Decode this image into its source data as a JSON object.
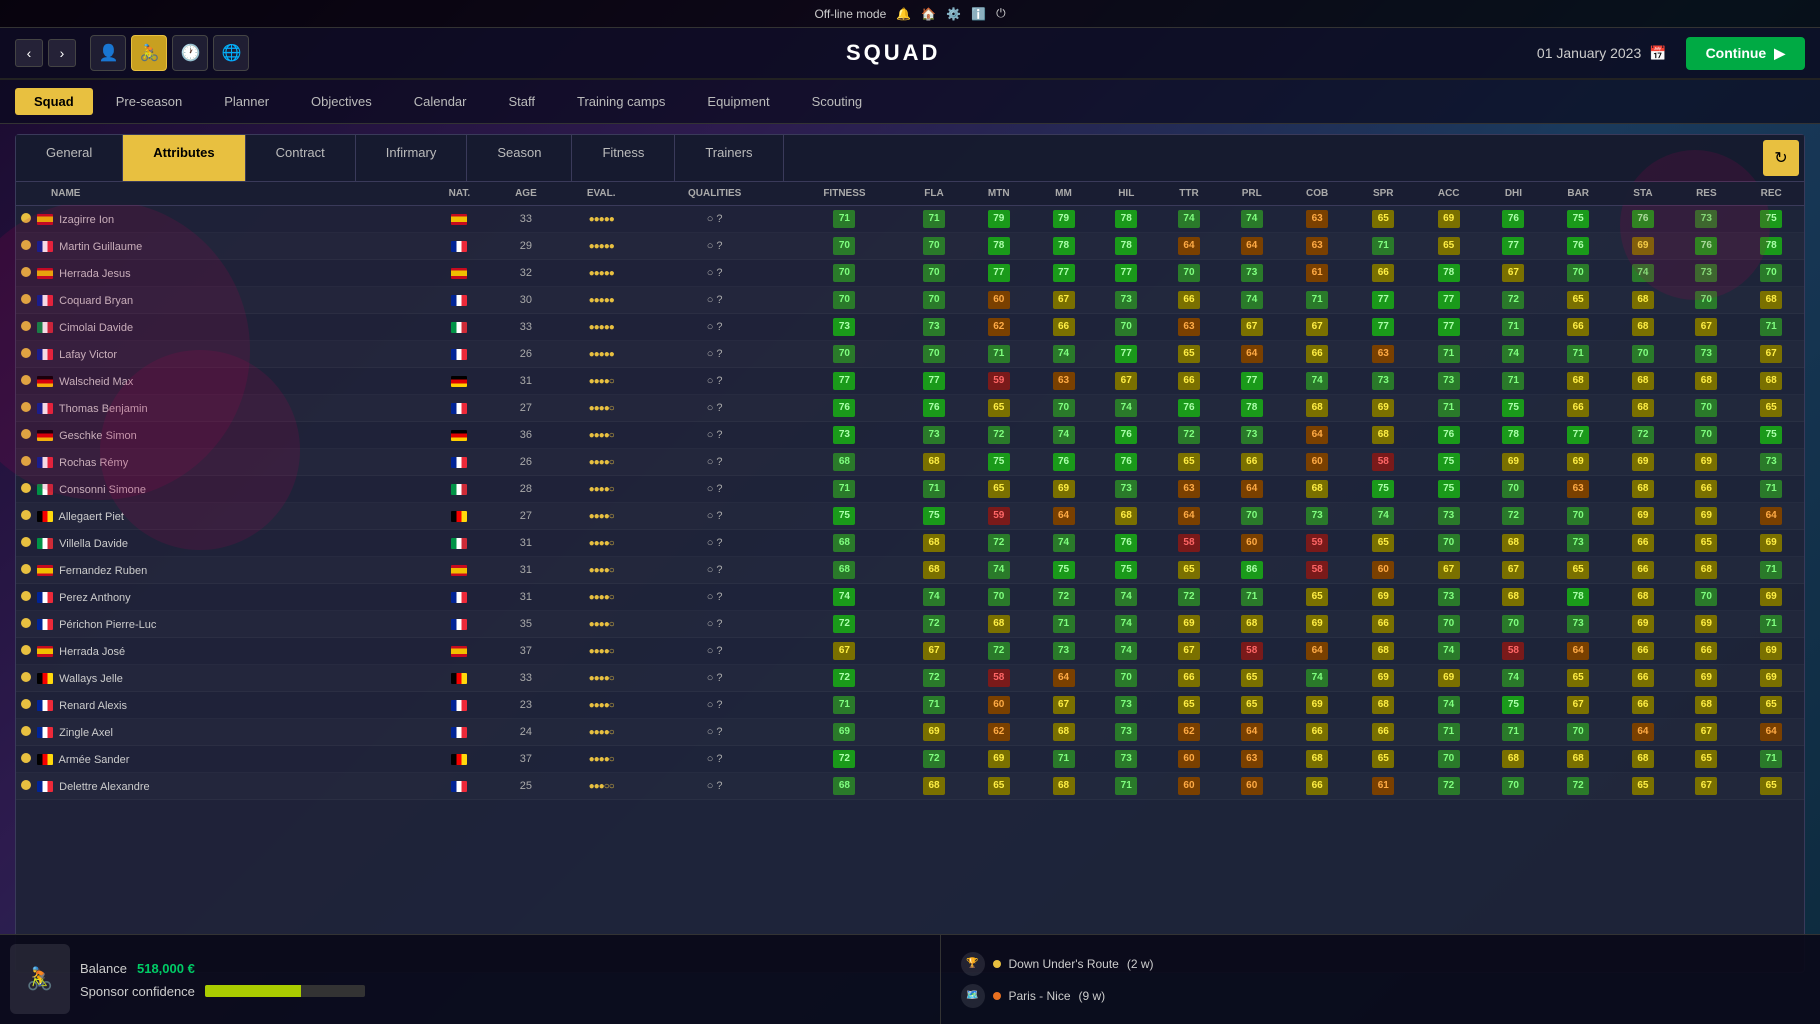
{
  "app": {
    "mode": "Off-line mode",
    "title": "SQUAD",
    "date": "01 January 2023",
    "continue_label": "Continue"
  },
  "tabs": [
    {
      "id": "squad",
      "label": "Squad",
      "active": true
    },
    {
      "id": "preseason",
      "label": "Pre-season",
      "active": false
    },
    {
      "id": "planner",
      "label": "Planner",
      "active": false
    },
    {
      "id": "objectives",
      "label": "Objectives",
      "active": false
    },
    {
      "id": "calendar",
      "label": "Calendar",
      "active": false
    },
    {
      "id": "staff",
      "label": "Staff",
      "active": false
    },
    {
      "id": "training-camps",
      "label": "Training camps",
      "active": false
    },
    {
      "id": "equipment",
      "label": "Equipment",
      "active": false
    },
    {
      "id": "scouting",
      "label": "Scouting",
      "active": false
    }
  ],
  "subtabs": [
    {
      "id": "general",
      "label": "General",
      "active": false
    },
    {
      "id": "attributes",
      "label": "Attributes",
      "active": true
    },
    {
      "id": "contract",
      "label": "Contract",
      "active": false
    },
    {
      "id": "infirmary",
      "label": "Infirmary",
      "active": false
    },
    {
      "id": "season",
      "label": "Season",
      "active": false
    },
    {
      "id": "fitness",
      "label": "Fitness",
      "active": false
    },
    {
      "id": "trainers",
      "label": "Trainers",
      "active": false
    }
  ],
  "table": {
    "columns": [
      "NAME",
      "NAT.",
      "AGE",
      "EVAL.",
      "QUALITIES",
      "FITNESS",
      "FLA",
      "MTN",
      "MM",
      "HIL",
      "TTR",
      "PRL",
      "COB",
      "SPR",
      "ACC",
      "DHI",
      "BAR",
      "STA",
      "RES",
      "REC"
    ],
    "players": [
      {
        "name": "Izagirre Ion",
        "nat": "es",
        "age": 33,
        "eval": 5,
        "fitness": 71,
        "FLA": 71,
        "MTN": 79,
        "MM": 79,
        "HIL": 78,
        "TTR": 74,
        "PRL": 74,
        "COB": 63,
        "SPR": 65,
        "ACC": 69,
        "DHI": 76,
        "BAR": 75,
        "STA": 76,
        "RES": 73,
        "REC": 75
      },
      {
        "name": "Martin Guillaume",
        "nat": "fr",
        "age": 29,
        "eval": 5,
        "fitness": 70,
        "FLA": 70,
        "MTN": 78,
        "MM": 78,
        "HIL": 78,
        "TTR": 64,
        "PRL": 64,
        "COB": 63,
        "SPR": 71,
        "ACC": 65,
        "DHI": 77,
        "BAR": 76,
        "STA": 69,
        "RES": 76,
        "REC": 78
      },
      {
        "name": "Herrada Jesus",
        "nat": "es",
        "age": 32,
        "eval": 5,
        "fitness": 70,
        "FLA": 70,
        "MTN": 77,
        "MM": 77,
        "HIL": 77,
        "TTR": 70,
        "PRL": 73,
        "COB": 61,
        "SPR": 66,
        "ACC": 78,
        "DHI": 67,
        "BAR": 70,
        "STA": 74,
        "RES": 73,
        "REC": 70
      },
      {
        "name": "Coquard Bryan",
        "nat": "fr",
        "age": 30,
        "eval": 5,
        "fitness": 70,
        "FLA": 70,
        "MTN": 60,
        "MM": 67,
        "HIL": 73,
        "TTR": 66,
        "PRL": 74,
        "COB": 71,
        "SPR": 77,
        "ACC": 77,
        "DHI": 72,
        "BAR": 65,
        "STA": 68,
        "RES": 70,
        "REC": 68
      },
      {
        "name": "Cimolai Davide",
        "nat": "it",
        "age": 33,
        "eval": 5,
        "fitness": 73,
        "FLA": 73,
        "MTN": 62,
        "MM": 66,
        "HIL": 70,
        "TTR": 63,
        "PRL": 67,
        "COB": 67,
        "SPR": 77,
        "ACC": 77,
        "DHI": 71,
        "BAR": 66,
        "STA": 68,
        "RES": 67,
        "REC": 71
      },
      {
        "name": "Lafay Victor",
        "nat": "fr",
        "age": 26,
        "eval": 5,
        "fitness": 70,
        "FLA": 70,
        "MTN": 71,
        "MM": 74,
        "HIL": 77,
        "TTR": 65,
        "PRL": 64,
        "COB": 66,
        "SPR": 63,
        "ACC": 71,
        "DHI": 74,
        "BAR": 71,
        "STA": 70,
        "RES": 73,
        "REC": 67
      },
      {
        "name": "Walscheid Max",
        "nat": "de",
        "age": 31,
        "eval": 4,
        "fitness": 77,
        "FLA": 77,
        "MTN": 59,
        "MM": 63,
        "HIL": 67,
        "TTR": 66,
        "PRL": 77,
        "COB": 74,
        "SPR": 73,
        "ACC": 73,
        "DHI": 71,
        "BAR": 68,
        "STA": 68,
        "RES": 68,
        "REC": 68
      },
      {
        "name": "Thomas Benjamin",
        "nat": "fr",
        "age": 27,
        "eval": 4,
        "fitness": 76,
        "FLA": 76,
        "MTN": 65,
        "MM": 70,
        "HIL": 74,
        "TTR": 76,
        "PRL": 78,
        "COB": 68,
        "SPR": 69,
        "ACC": 71,
        "DHI": 75,
        "BAR": 66,
        "STA": 68,
        "RES": 70,
        "REC": 65
      },
      {
        "name": "Geschke Simon",
        "nat": "de",
        "age": 36,
        "eval": 4,
        "fitness": 73,
        "FLA": 73,
        "MTN": 72,
        "MM": 74,
        "HIL": 76,
        "TTR": 72,
        "PRL": 73,
        "COB": 64,
        "SPR": 68,
        "ACC": 76,
        "DHI": 78,
        "BAR": 77,
        "STA": 72,
        "RES": 70,
        "REC": 75
      },
      {
        "name": "Rochas Rémy",
        "nat": "fr",
        "age": 26,
        "eval": 4,
        "fitness": 68,
        "FLA": 68,
        "MTN": 75,
        "MM": 76,
        "HIL": 76,
        "TTR": 65,
        "PRL": 66,
        "COB": 60,
        "SPR": 58,
        "ACC": 75,
        "DHI": 69,
        "BAR": 69,
        "STA": 69,
        "RES": 69,
        "REC": 73
      },
      {
        "name": "Consonni Simone",
        "nat": "it",
        "age": 28,
        "eval": 4,
        "fitness": 71,
        "FLA": 71,
        "MTN": 65,
        "MM": 69,
        "HIL": 73,
        "TTR": 63,
        "PRL": 64,
        "COB": 68,
        "SPR": 75,
        "ACC": 75,
        "DHI": 70,
        "BAR": 63,
        "STA": 68,
        "RES": 66,
        "REC": 71
      },
      {
        "name": "Allegaert Piet",
        "nat": "be",
        "age": 27,
        "eval": 4,
        "fitness": 75,
        "FLA": 75,
        "MTN": 59,
        "MM": 64,
        "HIL": 68,
        "TTR": 64,
        "PRL": 70,
        "COB": 73,
        "SPR": 74,
        "ACC": 73,
        "DHI": 72,
        "BAR": 70,
        "STA": 69,
        "REC": 64,
        "RES": 69
      },
      {
        "name": "Villella Davide",
        "nat": "it",
        "age": 31,
        "eval": 4,
        "fitness": 68,
        "FLA": 68,
        "MTN": 72,
        "MM": 74,
        "HIL": 76,
        "TTR": 58,
        "PRL": 60,
        "COB": 59,
        "SPR": 65,
        "ACC": 70,
        "DHI": 68,
        "BAR": 73,
        "STA": 66,
        "RES": 65,
        "REC": 69
      },
      {
        "name": "Fernandez Ruben",
        "nat": "es",
        "age": 31,
        "eval": 4,
        "fitness": 68,
        "FLA": 68,
        "MTN": 74,
        "MM": 75,
        "HIL": 75,
        "TTR": 65,
        "PRL": 86,
        "COB": 58,
        "SPR": 60,
        "ACC": 67,
        "DHI": 67,
        "BAR": 65,
        "STA": 66,
        "RES": 68,
        "REC": 71
      },
      {
        "name": "Perez Anthony",
        "nat": "fr",
        "age": 31,
        "eval": 4,
        "fitness": 74,
        "FLA": 74,
        "MTN": 70,
        "MM": 72,
        "HIL": 74,
        "TTR": 72,
        "PRL": 71,
        "COB": 65,
        "SPR": 69,
        "ACC": 73,
        "DHI": 68,
        "BAR": 78,
        "STA": 68,
        "RES": 70,
        "REC": 69
      },
      {
        "name": "Périchon Pierre-Luc",
        "nat": "fr",
        "age": 35,
        "eval": 4,
        "fitness": 72,
        "FLA": 72,
        "MTN": 68,
        "MM": 71,
        "HIL": 74,
        "TTR": 69,
        "PRL": 68,
        "COB": 69,
        "SPR": 66,
        "ACC": 70,
        "DHI": 70,
        "BAR": 73,
        "STA": 69,
        "RES": 69,
        "REC": 71
      },
      {
        "name": "Herrada José",
        "nat": "es",
        "age": 37,
        "eval": 4,
        "fitness": 67,
        "FLA": 67,
        "MTN": 72,
        "MM": 73,
        "HIL": 74,
        "TTR": 67,
        "PRL": 58,
        "COB": 64,
        "SPR": 68,
        "ACC": 74,
        "DHI": 58,
        "BAR": 64,
        "STA": 66,
        "RES": 66,
        "REC": 69
      },
      {
        "name": "Wallays Jelle",
        "nat": "be",
        "age": 33,
        "eval": 4,
        "fitness": 72,
        "FLA": 72,
        "MTN": 58,
        "MM": 64,
        "HIL": 70,
        "TTR": 66,
        "PRL": 65,
        "COB": 74,
        "SPR": 69,
        "ACC": 69,
        "DHI": 74,
        "BAR": 65,
        "STA": 66,
        "RES": 69,
        "REC": 69
      },
      {
        "name": "Renard Alexis",
        "nat": "fr",
        "age": 23,
        "eval": 4,
        "fitness": 71,
        "FLA": 71,
        "MTN": 60,
        "MM": 67,
        "HIL": 73,
        "TTR": 65,
        "PRL": 65,
        "COB": 69,
        "SPR": 68,
        "ACC": 74,
        "DHI": 75,
        "BAR": 67,
        "STA": 66,
        "RES": 68,
        "REC": 65
      },
      {
        "name": "Zingle Axel",
        "nat": "fr",
        "age": 24,
        "eval": 4,
        "fitness": 69,
        "FLA": 69,
        "MTN": 62,
        "MM": 68,
        "HIL": 73,
        "TTR": 62,
        "PRL": 64,
        "COB": 66,
        "SPR": 66,
        "ACC": 71,
        "DHI": 71,
        "BAR": 70,
        "STA": 64,
        "RES": 67,
        "REC": 64
      },
      {
        "name": "Armée Sander",
        "nat": "be",
        "age": 37,
        "eval": 4,
        "fitness": 72,
        "FLA": 72,
        "MTN": 69,
        "MM": 71,
        "HIL": 73,
        "TTR": 60,
        "PRL": 63,
        "COB": 68,
        "SPR": 65,
        "ACC": 70,
        "DHI": 68,
        "BAR": 68,
        "STA": 68,
        "RES": 65,
        "REC": 71
      },
      {
        "name": "Delettre Alexandre",
        "nat": "fr",
        "age": 25,
        "eval": 3,
        "fitness": 68,
        "FLA": 68,
        "MTN": 65,
        "MM": 68,
        "HIL": 71,
        "TTR": 60,
        "PRL": 60,
        "COB": 66,
        "SPR": 61,
        "ACC": 72,
        "DHI": 70,
        "BAR": 72,
        "STA": 65,
        "RES": 67,
        "REC": 65
      }
    ]
  },
  "bottom": {
    "balance_label": "Balance",
    "balance_amount": "518,000 €",
    "sponsor_label": "Sponsor confidence",
    "races": [
      {
        "name": "Down Under's Route",
        "detail": "(2 w)",
        "color": "yellow"
      },
      {
        "name": "Paris - Nice",
        "detail": "(9 w)",
        "color": "orange"
      }
    ]
  }
}
